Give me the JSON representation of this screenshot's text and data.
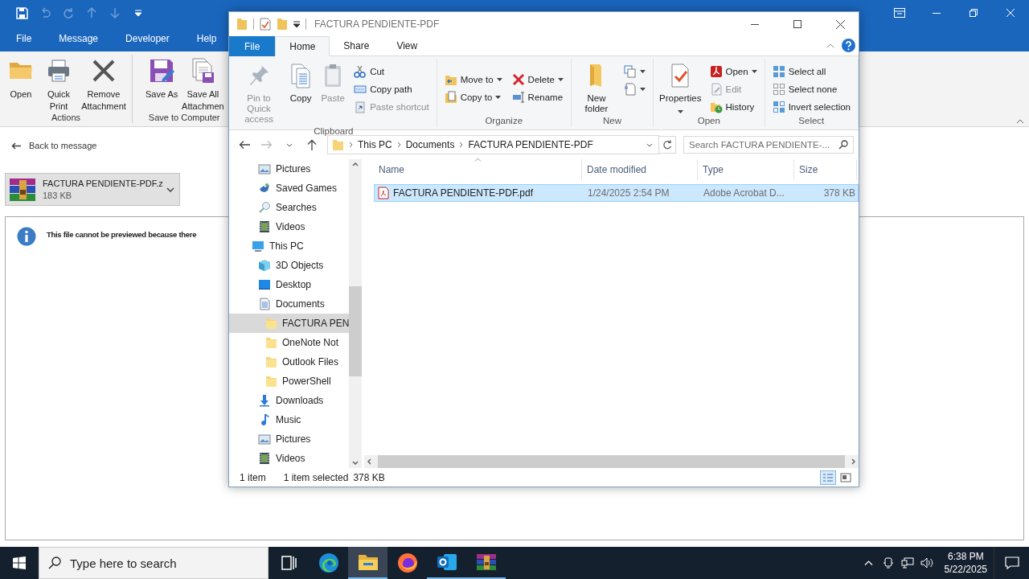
{
  "outlook": {
    "tabs": [
      "File",
      "Message",
      "Developer",
      "Help"
    ],
    "ribbon": [
      {
        "label": "Actions",
        "buttons": [
          {
            "label": "Open"
          },
          {
            "label": "Quick Print"
          },
          {
            "label": "Remove Attachment"
          }
        ]
      },
      {
        "label": "Save to Computer",
        "buttons": [
          {
            "label": "Save As"
          },
          {
            "label": "Save All Attachmen"
          }
        ]
      }
    ],
    "back_link": "Back to message",
    "attachment": {
      "name": "FACTURA PENDIENTE-PDF.z",
      "size": "183 KB"
    },
    "preview_message": "This file cannot be previewed because there"
  },
  "explorer": {
    "title": "FACTURA PENDIENTE-PDF",
    "tabs": [
      {
        "label": "File",
        "kind": "menu",
        "selected": false
      },
      {
        "label": "Home",
        "kind": "tab",
        "selected": true
      },
      {
        "label": "Share",
        "kind": "tab",
        "selected": false
      },
      {
        "label": "View",
        "kind": "tab",
        "selected": false
      }
    ],
    "ribbon": [
      {
        "label": "Clipboard",
        "buttons": [
          {
            "kind": "large",
            "label": "Pin to Quick access",
            "disabled": true,
            "dropdown": false
          },
          {
            "kind": "large",
            "label": "Copy",
            "disabled": false,
            "dropdown": false
          },
          {
            "kind": "large",
            "label": "Paste",
            "disabled": true,
            "dropdown": false
          },
          {
            "kind": "small",
            "label": "Cut",
            "disabled": false,
            "dropdown": false
          },
          {
            "kind": "small",
            "label": "Copy path",
            "disabled": false,
            "dropdown": false
          },
          {
            "kind": "small",
            "label": "Paste shortcut",
            "disabled": true,
            "dropdown": false
          }
        ]
      },
      {
        "label": "Organize",
        "buttons": [
          {
            "kind": "small",
            "label": "Move to",
            "disabled": false,
            "dropdown": true
          },
          {
            "kind": "small",
            "label": "Copy to",
            "disabled": false,
            "dropdown": true
          },
          {
            "kind": "small",
            "label": "Delete",
            "disabled": false,
            "dropdown": true
          },
          {
            "kind": "small",
            "label": "Rename",
            "disabled": false,
            "dropdown": false
          }
        ]
      },
      {
        "label": "New",
        "buttons": [
          {
            "kind": "large",
            "label": "New folder",
            "disabled": false,
            "dropdown": false
          },
          {
            "kind": "small",
            "disabled": false,
            "dropdown": true
          },
          {
            "kind": "small",
            "disabled": false,
            "dropdown": true
          }
        ]
      },
      {
        "label": "Open",
        "buttons": [
          {
            "kind": "large",
            "label": "Properties",
            "disabled": false,
            "dropdown": true
          },
          {
            "kind": "small",
            "label": "Open",
            "disabled": false,
            "dropdown": true
          },
          {
            "kind": "small",
            "label": "Edit",
            "disabled": true,
            "dropdown": false
          },
          {
            "kind": "small",
            "label": "History",
            "disabled": false,
            "dropdown": false
          }
        ]
      },
      {
        "label": "Select",
        "buttons": [
          {
            "kind": "small",
            "label": "Select all",
            "disabled": false,
            "dropdown": false
          },
          {
            "kind": "small",
            "label": "Select none",
            "disabled": false,
            "dropdown": false
          },
          {
            "kind": "small",
            "label": "Invert selection",
            "disabled": false,
            "dropdown": false
          }
        ]
      }
    ],
    "address": [
      "This PC",
      "Documents",
      "FACTURA PENDIENTE-PDF"
    ],
    "search": {
      "placeholder": "Search FACTURA PENDIENTE-..."
    },
    "nav_tree": [
      {
        "children": [
          {
            "label": "Pictures",
            "kind": "pictures",
            "selected": false
          },
          {
            "label": "Saved Games",
            "kind": "games",
            "selected": false
          },
          {
            "label": "Searches",
            "kind": "searches",
            "selected": false
          },
          {
            "label": "Videos",
            "kind": "videos",
            "selected": false
          }
        ]
      },
      {
        "label": "This PC",
        "kind": "pc",
        "selected": false,
        "children": [
          {
            "label": "3D Objects",
            "kind": "objects",
            "selected": false
          },
          {
            "label": "Desktop",
            "kind": "desktop",
            "selected": false
          },
          {
            "label": "Documents",
            "kind": "documents",
            "selected": false,
            "children": [
              {
                "label": "FACTURA PEN",
                "kind": "folder",
                "selected": true
              },
              {
                "label": "OneNote Not",
                "kind": "folder",
                "selected": false
              },
              {
                "label": "Outlook Files",
                "kind": "folder",
                "selected": false
              },
              {
                "label": "PowerShell",
                "kind": "folder",
                "selected": false
              }
            ]
          },
          {
            "label": "Downloads",
            "kind": "downloads",
            "selected": false
          },
          {
            "label": "Music",
            "kind": "music",
            "selected": false
          },
          {
            "label": "Pictures",
            "kind": "pictures",
            "selected": false
          },
          {
            "label": "Videos",
            "kind": "videos",
            "selected": false
          }
        ]
      }
    ],
    "columns": [
      "Name",
      "Date modified",
      "Type",
      "Size"
    ],
    "files": [
      {
        "name": "FACTURA PENDIENTE-PDF.pdf",
        "date_modified": "1/24/2025 2:54 PM",
        "type": "Adobe Acrobat D...",
        "size": "378 KB",
        "selected": true
      }
    ],
    "status": {
      "count": "1 item",
      "selection": "1 item selected",
      "size": "378 KB"
    }
  },
  "taskbar": {
    "search": {
      "placeholder": "Type here to search"
    },
    "apps": [
      {
        "kind": "taskview",
        "running": false,
        "selected": false
      },
      {
        "kind": "edge",
        "running": false,
        "selected": false
      },
      {
        "kind": "explorer",
        "running": true,
        "selected": true
      },
      {
        "kind": "firefox",
        "running": false,
        "selected": false
      },
      {
        "kind": "outlook",
        "running": true,
        "selected": false
      },
      {
        "kind": "winrar",
        "running": true,
        "selected": false
      }
    ],
    "time": "6:38 PM",
    "date": "5/22/2025"
  }
}
